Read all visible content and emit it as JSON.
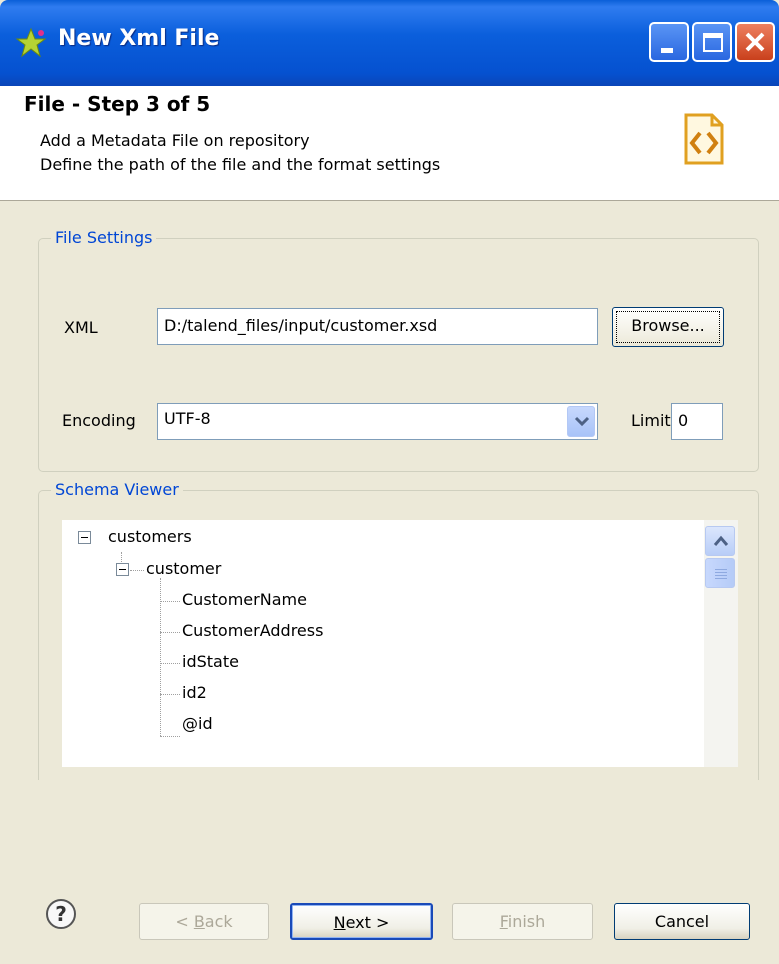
{
  "window": {
    "title": "New Xml File"
  },
  "header": {
    "step_title": "File - Step 3 of 5",
    "description_line1": "Add a Metadata File on repository",
    "description_line2": "Define the path of the file and the format settings"
  },
  "file_settings": {
    "legend": "File Settings",
    "xml_label": "XML",
    "xml_path": "D:/talend_files/input/customer.xsd",
    "browse_label": "Browse...",
    "encoding_label": "Encoding",
    "encoding_value": "UTF-8",
    "limit_label": "Limit",
    "limit_value": "0"
  },
  "schema_viewer": {
    "legend": "Schema Viewer",
    "tree": {
      "root": "customers",
      "child": "customer",
      "leaves": [
        "CustomerName",
        "CustomerAddress",
        "idState",
        "id2",
        "@id"
      ]
    }
  },
  "buttons": {
    "back_prefix": "< ",
    "back_mnemonic": "B",
    "back_rest": "ack",
    "next_mnemonic": "N",
    "next_rest": "ext >",
    "finish_mnemonic": "F",
    "finish_rest": "inish",
    "cancel": "Cancel"
  },
  "colors": {
    "titlebar": "#0551d0",
    "legend_text": "#0046d5",
    "dialog_bg": "#ece9d8"
  }
}
